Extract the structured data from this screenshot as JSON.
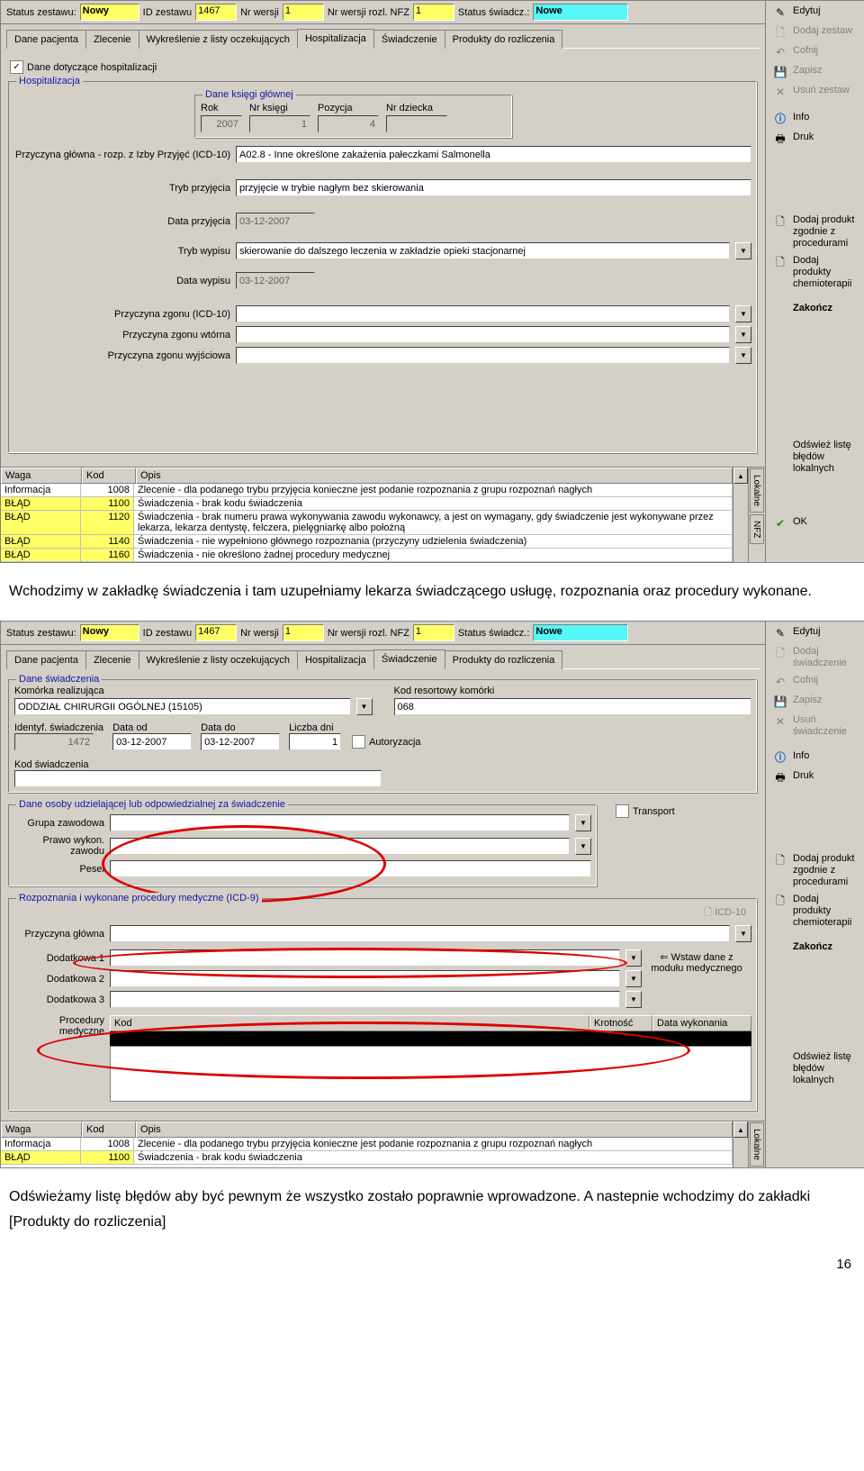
{
  "top": {
    "status_label": "Status zestawu:",
    "status": "Nowy",
    "id_label": "ID zestawu",
    "id": "1467",
    "ver_label": "Nr wersji",
    "ver": "1",
    "nfz_label": "Nr wersji rozl. NFZ",
    "nfz": "1",
    "swiad_label": "Status świadcz.:",
    "swiad": "Nowe"
  },
  "tabs": [
    "Dane pacjenta",
    "Zlecenie",
    "Wykreślenie z listy oczekujących",
    "Hospitalizacja",
    "Świadczenie",
    "Produkty do rozliczenia"
  ],
  "active_upper": 3,
  "active_lower": 4,
  "chk_hosp": "Dane dotyczące hospitalizacji",
  "grp_hosp_title": "Hospitalizacja",
  "ksiegi": {
    "title": "Dane księgi głównej",
    "rok": "Rok",
    "rok_v": "2007",
    "nr": "Nr księgi",
    "nr_v": "1",
    "poz": "Pozycja",
    "poz_v": "4",
    "dziecko": "Nr dziecka",
    "dziecko_v": ""
  },
  "fields": {
    "przyczyna_glowna_l": "Przyczyna główna - rozp. z Izby Przyjęć (ICD-10)",
    "przyczyna_glowna_v": "A02.8 - Inne określone zakażenia pałeczkami Salmonella",
    "tryb_przyjecia_l": "Tryb przyjęcia",
    "tryb_przyjecia_v": "przyjęcie w trybie nagłym bez skierowania",
    "data_przyjecia_l": "Data przyjęcia",
    "data_przyjecia_v": "03-12-2007",
    "tryb_wypisu_l": "Tryb wypisu",
    "tryb_wypisu_v": "skierowanie do dalszego leczenia w zakładzie opieki stacjonarnej",
    "data_wypisu_l": "Data wypisu",
    "data_wypisu_v": "03-12-2007",
    "zgon_l": "Przyczyna zgonu (ICD-10)",
    "zgon_wtorna_l": "Przyczyna zgonu wtórna",
    "zgon_wyj_l": "Przyczyna zgonu wyjściowa"
  },
  "err_hdr": {
    "waga": "Waga",
    "kod": "Kod",
    "opis": "Opis"
  },
  "errors_upper": [
    {
      "w": "Informacja",
      "k": "1008",
      "o": "Zlecenie - dla podanego trybu przyjęcia konieczne jest podanie rozpoznania z grupu rozpoznań nagłych",
      "cls": ""
    },
    {
      "w": "BŁĄD",
      "k": "1100",
      "o": "Świadczenia - brak kodu świadczenia",
      "cls": "err"
    },
    {
      "w": "BŁĄD",
      "k": "1120",
      "o": "Świadczenia - brak numeru prawa wykonywania zawodu wykonawcy, a jest on wymagany, gdy świadczenie jest wykonywane przez lekarza, lekarza dentystę, felczera, pielęgniarkę albo położną",
      "cls": "err"
    },
    {
      "w": "BŁĄD",
      "k": "1140",
      "o": "Świadczenia - nie wypełniono głównego rozpoznania (przyczyny udzielenia świadczenia)",
      "cls": "err"
    },
    {
      "w": "BŁĄD",
      "k": "1160",
      "o": "Świadczenia - nie określono żadnej procedury medycznej",
      "cls": "err"
    }
  ],
  "errors_lower": [
    {
      "w": "Informacja",
      "k": "1008",
      "o": "Zlecenie - dla podanego trybu przyjęcia konieczne jest podanie rozpoznania z grupu rozpoznań nagłych",
      "cls": ""
    },
    {
      "w": "BŁĄD",
      "k": "1100",
      "o": "Świadczenia - brak kodu świadczenia",
      "cls": "err"
    }
  ],
  "vtabs": {
    "lokalne": "Lokalne",
    "nfz": "NFZ"
  },
  "side_upper": {
    "edytuj": "Edytuj",
    "dodaj_zestaw": "Dodaj zestaw",
    "cofnij": "Cofnij",
    "zapisz": "Zapisz",
    "usun": "Usuń zestaw",
    "info": "Info",
    "druk": "Druk",
    "dodaj_prod": "Dodaj produkt zgodnie z procedurami",
    "dodaj_chem": "Dodaj produkty chemioterapii",
    "zakoncz": "Zakończ",
    "odswiez": "Odśwież listę błędów lokalnych",
    "ok": "OK"
  },
  "side_lower": {
    "edytuj": "Edytuj",
    "dodaj_sw": "Dodaj świadczenie",
    "cofnij": "Cofnij",
    "zapisz": "Zapisz",
    "usun_sw": "Usuń świadczenie",
    "info": "Info",
    "druk": "Druk",
    "dodaj_prod": "Dodaj produkt zgodnie z procedurami",
    "dodaj_chem": "Dodaj produkty chemioterapii",
    "zakoncz": "Zakończ",
    "odswiez": "Odśwież listę błędów lokalnych"
  },
  "swiad": {
    "grp": "Dane świadczenia",
    "kom_l": "Komórka realizująca",
    "kom_v": "ODDZIAŁ CHIRURGII OGÓLNEJ (15105)",
    "kod_res_l": "Kod resortowy komórki",
    "kod_res_v": "068",
    "ident_l": "Identyf. świadczenia",
    "ident_v": "1472",
    "dod_l": "Data od",
    "dod_v": "03-12-2007",
    "ddo_l": "Data do",
    "ddo_v": "03-12-2007",
    "dni_l": "Liczba dni",
    "dni_v": "1",
    "autoriz": "Autoryzacja",
    "kod_sw_l": "Kod świadczenia",
    "osoby": "Dane osoby udzielającej lub odpowiedzialnej za świadczenie",
    "transport": "Transport",
    "grupa_l": "Grupa zawodowa",
    "prawo_l": "Prawo wykon. zawodu",
    "pesel_l": "Pesel",
    "rozp_grp": "Rozpoznania i wykonane procedury medyczne (ICD-9)",
    "icd10_btn": "ICD-10",
    "przyczyna_l": "Przyczyna główna",
    "dod1": "Dodatkowa 1",
    "dod2": "Dodatkowa 2",
    "dod3": "Dodatkowa 3",
    "wstaw": "Wstaw dane z modułu medycznego",
    "proc_l": "Procedury medyczne",
    "proc_hdr": {
      "kod": "Kod",
      "krot": "Krotność",
      "data": "Data wykonania"
    }
  },
  "doc": {
    "p1": "Wchodzimy w zakładkę świadczenia i tam uzupełniamy lekarza świadczącego usługę, rozpoznania oraz procedury wykonane.",
    "p2": "Odświeżamy listę błędów aby być pewnym że wszystko zostało poprawnie wprowadzone. A nastepnie wchodzimy do zakładki [Produkty do rozliczenia]",
    "page": "16"
  }
}
